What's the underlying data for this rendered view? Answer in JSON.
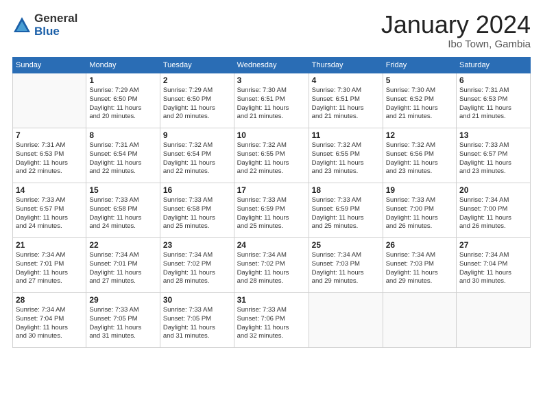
{
  "logo": {
    "general": "General",
    "blue": "Blue"
  },
  "header": {
    "month": "January 2024",
    "location": "Ibo Town, Gambia"
  },
  "weekdays": [
    "Sunday",
    "Monday",
    "Tuesday",
    "Wednesday",
    "Thursday",
    "Friday",
    "Saturday"
  ],
  "weeks": [
    [
      {
        "day": "",
        "info": ""
      },
      {
        "day": "1",
        "info": "Sunrise: 7:29 AM\nSunset: 6:50 PM\nDaylight: 11 hours\nand 20 minutes."
      },
      {
        "day": "2",
        "info": "Sunrise: 7:29 AM\nSunset: 6:50 PM\nDaylight: 11 hours\nand 20 minutes."
      },
      {
        "day": "3",
        "info": "Sunrise: 7:30 AM\nSunset: 6:51 PM\nDaylight: 11 hours\nand 21 minutes."
      },
      {
        "day": "4",
        "info": "Sunrise: 7:30 AM\nSunset: 6:51 PM\nDaylight: 11 hours\nand 21 minutes."
      },
      {
        "day": "5",
        "info": "Sunrise: 7:30 AM\nSunset: 6:52 PM\nDaylight: 11 hours\nand 21 minutes."
      },
      {
        "day": "6",
        "info": "Sunrise: 7:31 AM\nSunset: 6:53 PM\nDaylight: 11 hours\nand 21 minutes."
      }
    ],
    [
      {
        "day": "7",
        "info": "Sunrise: 7:31 AM\nSunset: 6:53 PM\nDaylight: 11 hours\nand 22 minutes."
      },
      {
        "day": "8",
        "info": "Sunrise: 7:31 AM\nSunset: 6:54 PM\nDaylight: 11 hours\nand 22 minutes."
      },
      {
        "day": "9",
        "info": "Sunrise: 7:32 AM\nSunset: 6:54 PM\nDaylight: 11 hours\nand 22 minutes."
      },
      {
        "day": "10",
        "info": "Sunrise: 7:32 AM\nSunset: 6:55 PM\nDaylight: 11 hours\nand 22 minutes."
      },
      {
        "day": "11",
        "info": "Sunrise: 7:32 AM\nSunset: 6:55 PM\nDaylight: 11 hours\nand 23 minutes."
      },
      {
        "day": "12",
        "info": "Sunrise: 7:32 AM\nSunset: 6:56 PM\nDaylight: 11 hours\nand 23 minutes."
      },
      {
        "day": "13",
        "info": "Sunrise: 7:33 AM\nSunset: 6:57 PM\nDaylight: 11 hours\nand 23 minutes."
      }
    ],
    [
      {
        "day": "14",
        "info": "Sunrise: 7:33 AM\nSunset: 6:57 PM\nDaylight: 11 hours\nand 24 minutes."
      },
      {
        "day": "15",
        "info": "Sunrise: 7:33 AM\nSunset: 6:58 PM\nDaylight: 11 hours\nand 24 minutes."
      },
      {
        "day": "16",
        "info": "Sunrise: 7:33 AM\nSunset: 6:58 PM\nDaylight: 11 hours\nand 25 minutes."
      },
      {
        "day": "17",
        "info": "Sunrise: 7:33 AM\nSunset: 6:59 PM\nDaylight: 11 hours\nand 25 minutes."
      },
      {
        "day": "18",
        "info": "Sunrise: 7:33 AM\nSunset: 6:59 PM\nDaylight: 11 hours\nand 25 minutes."
      },
      {
        "day": "19",
        "info": "Sunrise: 7:33 AM\nSunset: 7:00 PM\nDaylight: 11 hours\nand 26 minutes."
      },
      {
        "day": "20",
        "info": "Sunrise: 7:34 AM\nSunset: 7:00 PM\nDaylight: 11 hours\nand 26 minutes."
      }
    ],
    [
      {
        "day": "21",
        "info": "Sunrise: 7:34 AM\nSunset: 7:01 PM\nDaylight: 11 hours\nand 27 minutes."
      },
      {
        "day": "22",
        "info": "Sunrise: 7:34 AM\nSunset: 7:01 PM\nDaylight: 11 hours\nand 27 minutes."
      },
      {
        "day": "23",
        "info": "Sunrise: 7:34 AM\nSunset: 7:02 PM\nDaylight: 11 hours\nand 28 minutes."
      },
      {
        "day": "24",
        "info": "Sunrise: 7:34 AM\nSunset: 7:02 PM\nDaylight: 11 hours\nand 28 minutes."
      },
      {
        "day": "25",
        "info": "Sunrise: 7:34 AM\nSunset: 7:03 PM\nDaylight: 11 hours\nand 29 minutes."
      },
      {
        "day": "26",
        "info": "Sunrise: 7:34 AM\nSunset: 7:03 PM\nDaylight: 11 hours\nand 29 minutes."
      },
      {
        "day": "27",
        "info": "Sunrise: 7:34 AM\nSunset: 7:04 PM\nDaylight: 11 hours\nand 30 minutes."
      }
    ],
    [
      {
        "day": "28",
        "info": "Sunrise: 7:34 AM\nSunset: 7:04 PM\nDaylight: 11 hours\nand 30 minutes."
      },
      {
        "day": "29",
        "info": "Sunrise: 7:33 AM\nSunset: 7:05 PM\nDaylight: 11 hours\nand 31 minutes."
      },
      {
        "day": "30",
        "info": "Sunrise: 7:33 AM\nSunset: 7:05 PM\nDaylight: 11 hours\nand 31 minutes."
      },
      {
        "day": "31",
        "info": "Sunrise: 7:33 AM\nSunset: 7:06 PM\nDaylight: 11 hours\nand 32 minutes."
      },
      {
        "day": "",
        "info": ""
      },
      {
        "day": "",
        "info": ""
      },
      {
        "day": "",
        "info": ""
      }
    ]
  ]
}
